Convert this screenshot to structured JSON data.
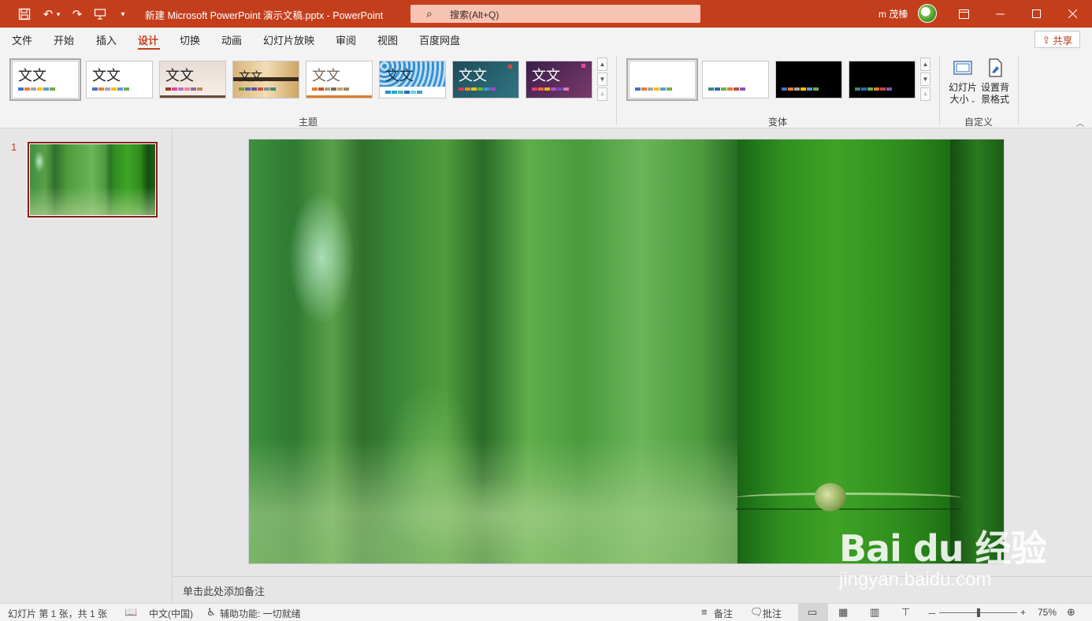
{
  "titlebar": {
    "document_title": "新建 Microsoft PowerPoint 演示文稿.pptx  -  PowerPoint",
    "search_placeholder": "搜索(Alt+Q)",
    "user_name": "m 茂榛",
    "icons": [
      "save-icon",
      "undo-icon",
      "redo-icon",
      "present-from-beginning-icon",
      "customize-toolbar-icon"
    ],
    "window_buttons": [
      "ribbon-display-icon",
      "minimize-icon",
      "maximize-icon",
      "close-icon"
    ],
    "accent_color": "#c43e1c"
  },
  "tabs": {
    "items": [
      {
        "label": "文件"
      },
      {
        "label": "开始"
      },
      {
        "label": "插入"
      },
      {
        "label": "设计"
      },
      {
        "label": "切换"
      },
      {
        "label": "动画"
      },
      {
        "label": "幻灯片放映"
      },
      {
        "label": "审阅"
      },
      {
        "label": "视图"
      },
      {
        "label": "百度网盘"
      }
    ],
    "active": "设计",
    "share_label": "共享"
  },
  "ribbon": {
    "themes_group_label": "主题",
    "variants_group_label": "变体",
    "customize_group_label": "自定义",
    "theme_thumb_text": "文文",
    "theme_thumb_text_alt": "文文",
    "themes": [
      {
        "name": "office-theme",
        "selected": true
      },
      {
        "name": "office-theme-2"
      },
      {
        "name": "theme-3"
      },
      {
        "name": "theme-4"
      },
      {
        "name": "theme-5"
      },
      {
        "name": "theme-6"
      },
      {
        "name": "theme-7"
      },
      {
        "name": "theme-8"
      }
    ],
    "slide_size_label_1": "幻灯片",
    "slide_size_label_2": "大小",
    "format_bg_label_1": "设置背",
    "format_bg_label_2": "景格式"
  },
  "slides_pane": {
    "slide_number": "1"
  },
  "notes": {
    "placeholder": "单击此处添加备注"
  },
  "status": {
    "slide_info": "幻灯片 第 1 张，共 1 张",
    "language": "中文(中国)",
    "accessibility": "辅助功能: 一切就绪",
    "notes_label": "备注",
    "comments_label": "批注",
    "zoom_minus": "－",
    "zoom_plus": "+",
    "zoom_level": "75%",
    "zoom_fraction": 0.5
  },
  "watermark": {
    "brand": "Bai du 经验",
    "url": "jingyan.baidu.com"
  }
}
